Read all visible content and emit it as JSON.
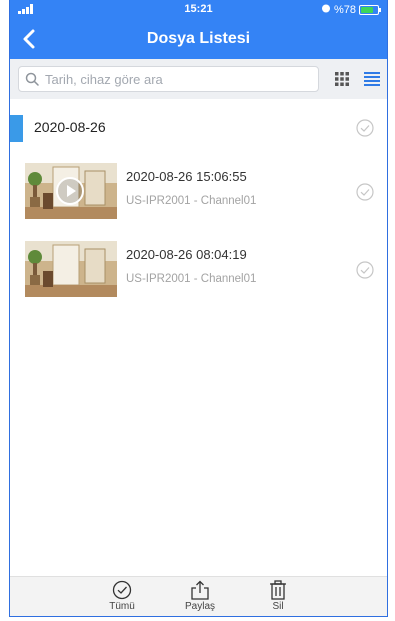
{
  "status_bar": {
    "time": "15:21",
    "battery": "%78",
    "battery_fraction": 0.78
  },
  "nav": {
    "title": "Dosya Listesi"
  },
  "search": {
    "placeholder": "Tarih, cihaz göre ara",
    "value": ""
  },
  "groups": [
    {
      "date": "2020-08-26",
      "items": [
        {
          "datetime": "2020-08-26 15:06:55",
          "device": "US-IPR2001 - Channel01",
          "type": "video"
        },
        {
          "datetime": "2020-08-26 08:04:19",
          "device": "US-IPR2001 - Channel01",
          "type": "image"
        }
      ]
    }
  ],
  "toolbar": {
    "all_label": "Tümü",
    "share_label": "Paylaş",
    "delete_label": "Sil"
  },
  "colors": {
    "primary": "#3483f5",
    "accent_bar": "#3a9ae8",
    "battery_fill": "#3dd65a"
  }
}
